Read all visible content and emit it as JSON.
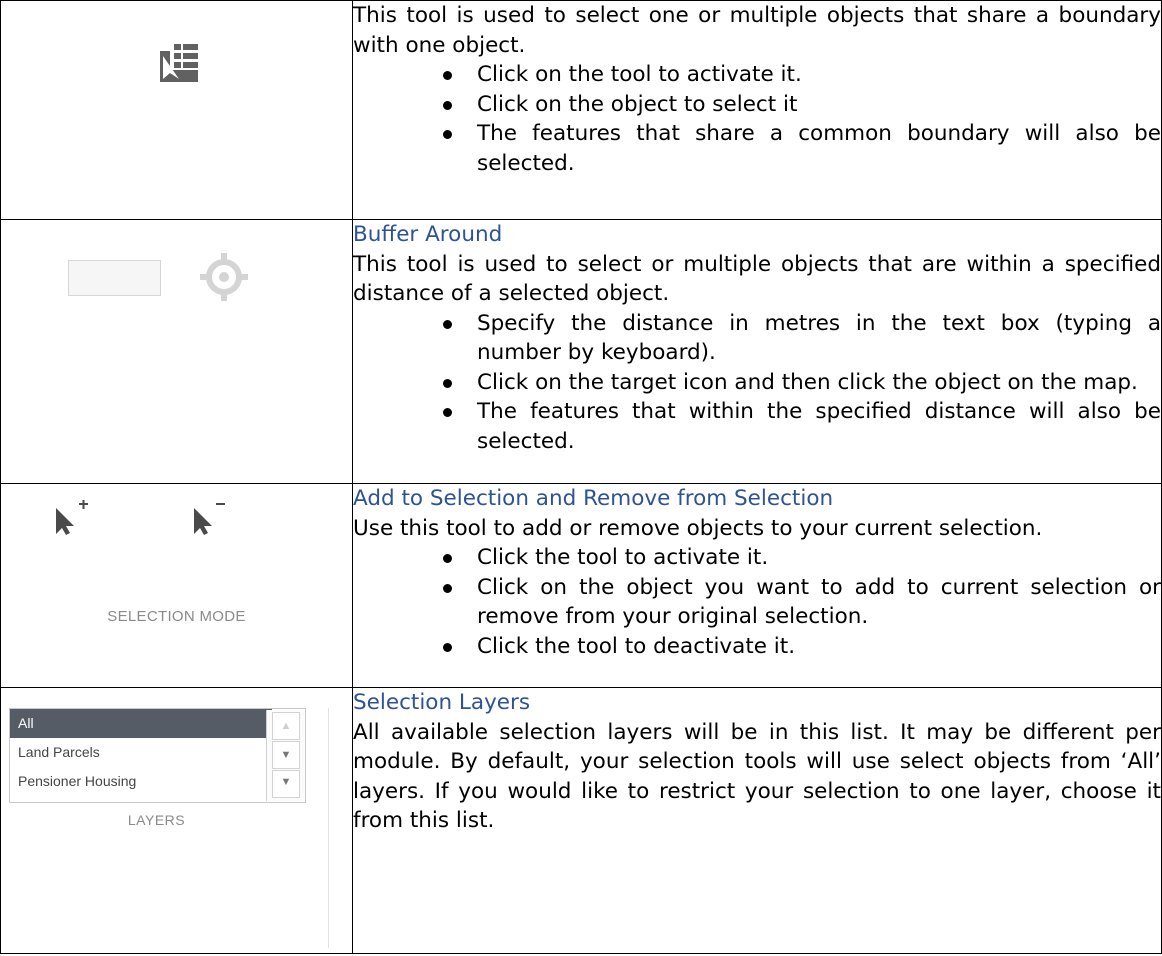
{
  "rows": [
    {
      "heading": "",
      "intro": "This tool is used to select one or multiple objects that share a boundary with one object.",
      "bullets": [
        "Click on the tool to activate it.",
        "Click on the object to select it",
        "The features that share a common boundary will also be selected."
      ],
      "icon": "adjacent-selection-icon"
    },
    {
      "heading": "Buffer Around",
      "intro": "This tool is used to select or multiple objects that are within a specified distance of a selected object.",
      "bullets": [
        "Specify the distance in metres in the text box (typing a number by keyboard).",
        "Click on the target icon and then click the object on the map.",
        "The features that within the specified distance will also be selected."
      ],
      "icon": "target-icon"
    },
    {
      "heading": "Add to Selection and Remove from Selection",
      "intro": "Use this tool to add or remove objects to your current selection.",
      "bullets": [
        "Click the tool to activate it.",
        "Click on the object you want to add to current selection or remove from your original selection.",
        "Click the tool to deactivate it."
      ],
      "icon_label": "SELECTION MODE",
      "icons": [
        "cursor-plus-icon",
        "cursor-minus-icon"
      ]
    },
    {
      "heading": "Selection Layers",
      "intro": "All available selection layers will be in this list. It may be different per module. By default, your selection tools will use select objects from ‘All’ layers. If you would like to restrict your selection to one layer, choose it from this list.",
      "layers": {
        "items": [
          "All",
          "Land Parcels",
          "Pensioner Housing"
        ],
        "selected": "All",
        "caption": "LAYERS"
      }
    }
  ],
  "colors": {
    "heading": "#2e5395",
    "icon_gray": "#616161",
    "selected_layer_bg": "#555c66"
  }
}
